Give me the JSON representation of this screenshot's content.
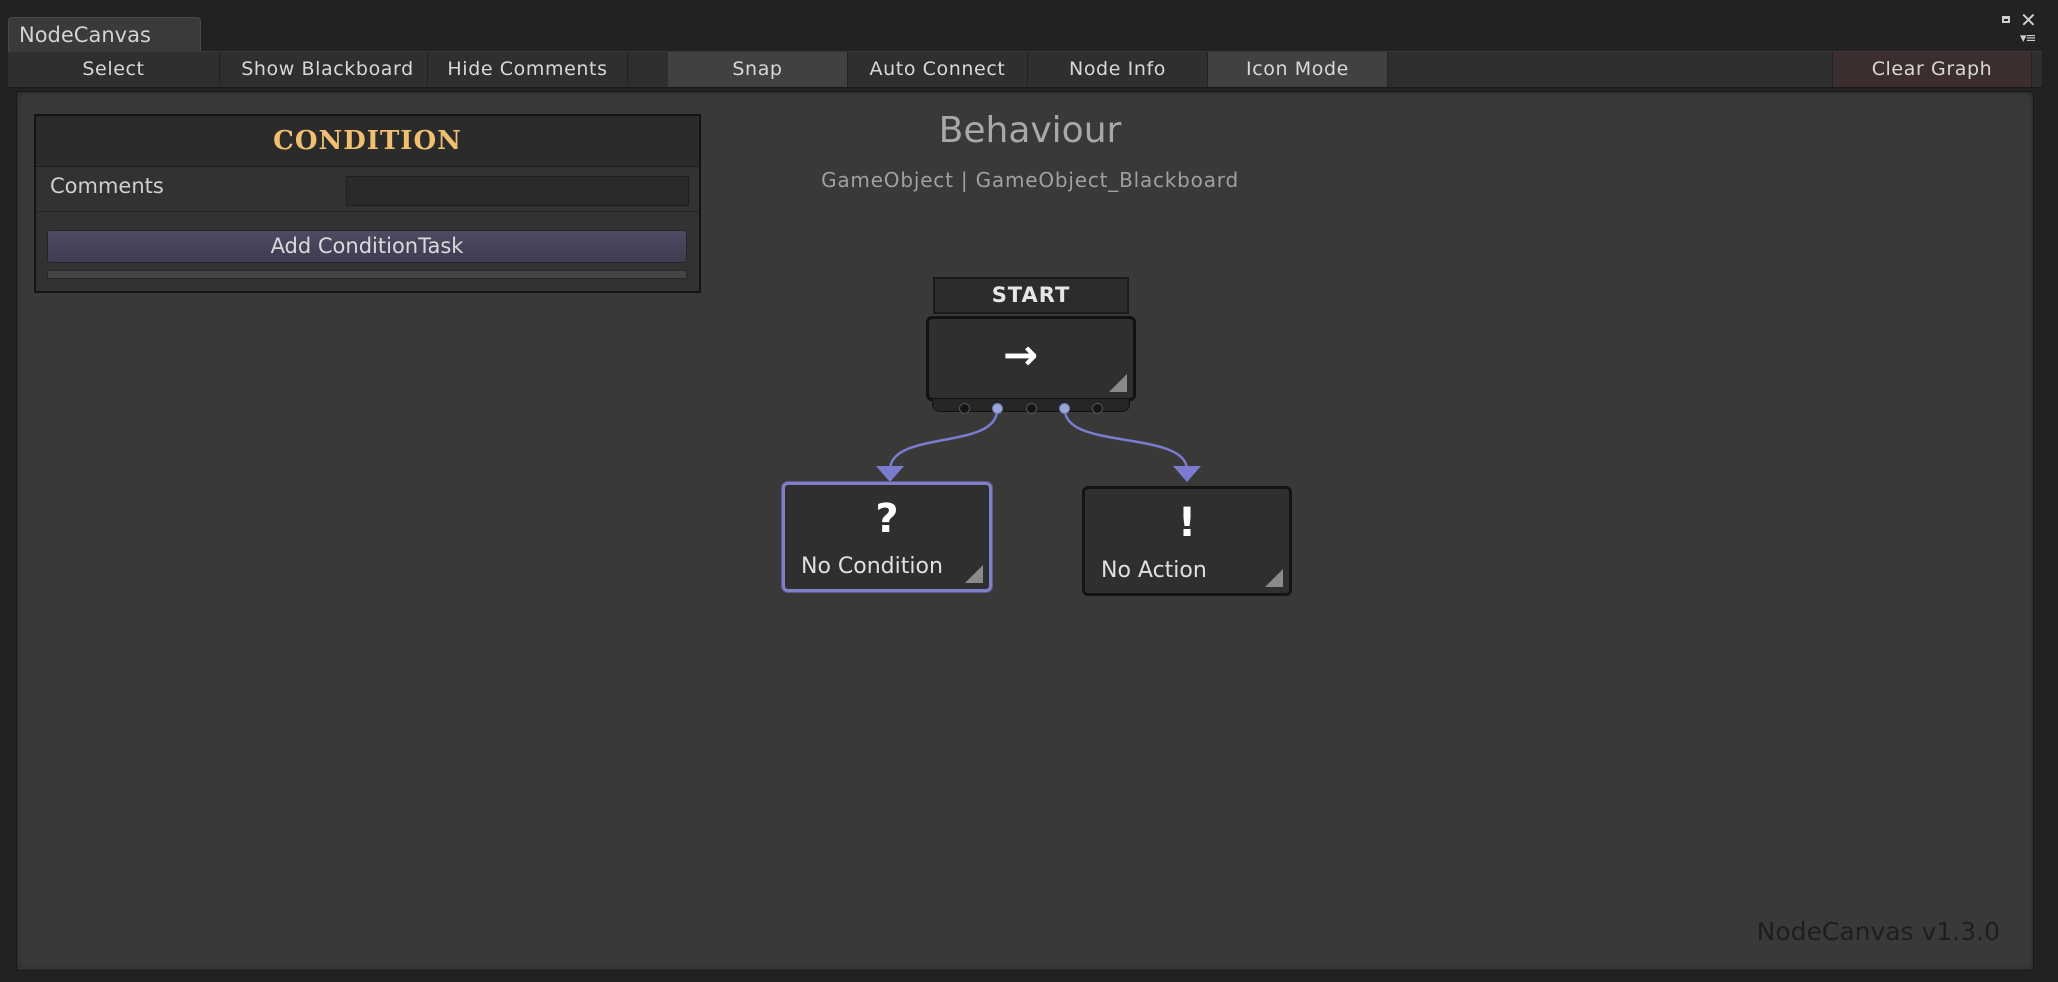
{
  "window": {
    "tab_title": "NodeCanvas",
    "controls": {
      "maximize": "maximize-icon",
      "close": "✕",
      "menu": "▾≡"
    }
  },
  "toolbar": {
    "select": "Select",
    "show_blackboard": "Show Blackboard",
    "hide_comments": "Hide Comments",
    "snap": "Snap",
    "auto_connect": "Auto Connect",
    "node_info": "Node Info",
    "icon_mode": "Icon Mode",
    "clear_graph": "Clear Graph"
  },
  "inspector": {
    "title": "CONDITION",
    "comments_label": "Comments",
    "comments_value": "",
    "add_button": "Add ConditionTask"
  },
  "graph": {
    "title": "Behaviour",
    "subtitle": "GameObject | GameObject_Blackboard",
    "start_label": "START",
    "start_icon": "→",
    "nodes": [
      {
        "icon": "?",
        "label": "No Condition",
        "selected": true
      },
      {
        "icon": "!",
        "label": "No Action",
        "selected": false
      }
    ],
    "connection_color": "#7b7bd0"
  },
  "footer": {
    "version": "NodeCanvas v1.3.0"
  }
}
